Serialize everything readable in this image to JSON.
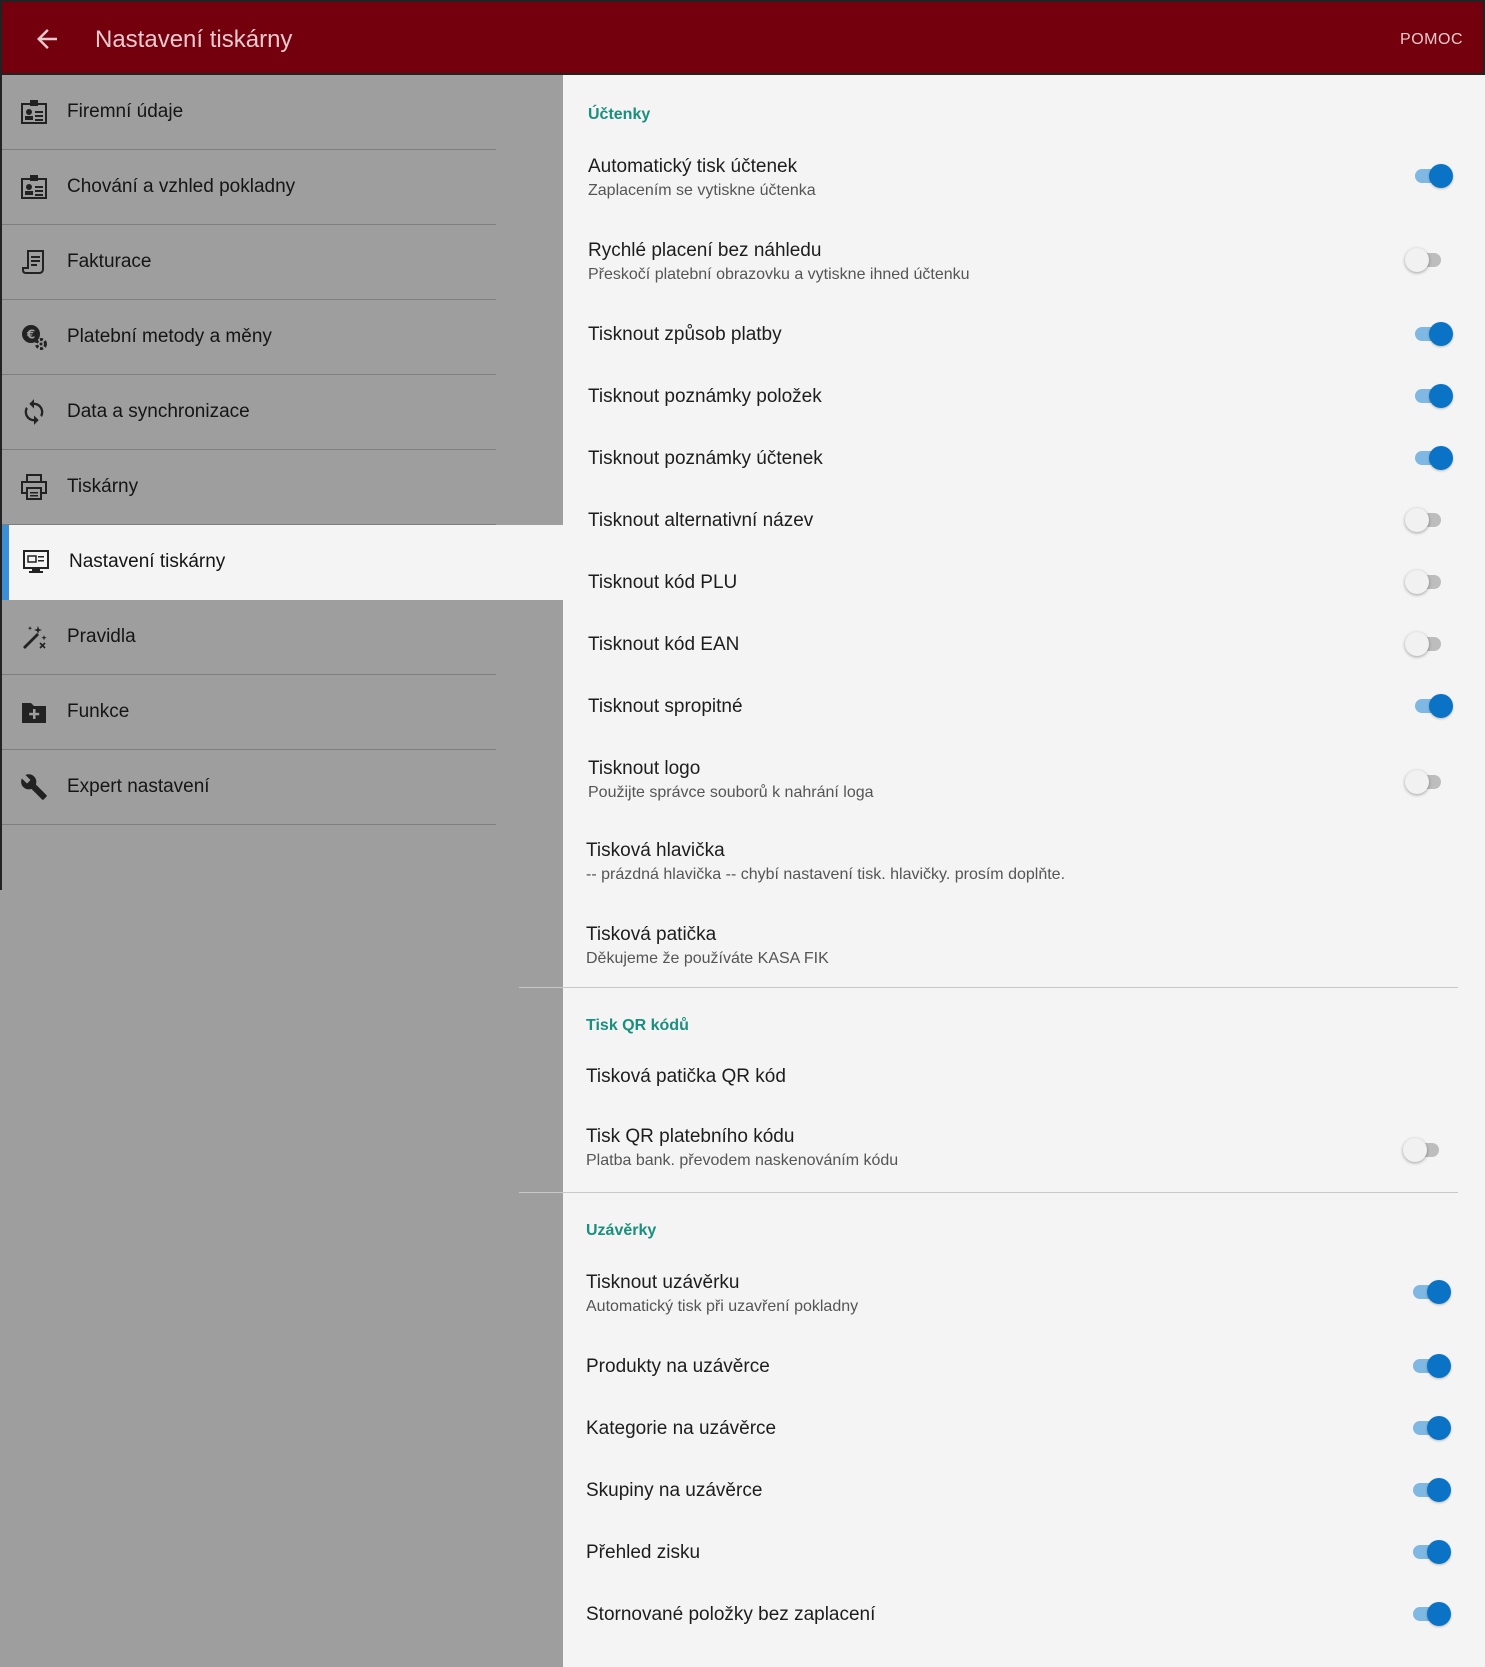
{
  "appbar": {
    "title": "Nastavení tiskárny",
    "help_label": "POMOC",
    "color": "#75000d"
  },
  "sidebar": {
    "items": [
      {
        "label": "Firemní údaje",
        "icon": "company-card-icon",
        "active": false
      },
      {
        "label": "Chování a vzhled pokladny",
        "icon": "company-card-icon",
        "active": false
      },
      {
        "label": "Fakturace",
        "icon": "invoice-icon",
        "active": false
      },
      {
        "label": "Platební metody a měny",
        "icon": "currency-settings-icon",
        "active": false
      },
      {
        "label": "Data a synchronizace",
        "icon": "sync-icon",
        "active": false
      },
      {
        "label": "Tiskárny",
        "icon": "printer-icon",
        "active": false
      },
      {
        "label": "Nastavení tiskárny",
        "icon": "printer-settings-icon",
        "active": true
      },
      {
        "label": "Pravidla",
        "icon": "magic-wand-icon",
        "active": false
      },
      {
        "label": "Funkce",
        "icon": "folder-plus-icon",
        "active": false
      },
      {
        "label": "Expert nastavení",
        "icon": "wrench-icon",
        "active": false
      }
    ]
  },
  "sections": {
    "receipts": "Účtenky",
    "qr": "Tisk QR kódů",
    "closures": "Uzávěrky"
  },
  "settings": [
    {
      "title": "Automatický tisk účtenek",
      "subtitle": "Zaplacením se vytiskne účtenka",
      "toggle": true
    },
    {
      "title": "Rychlé placení bez náhledu",
      "subtitle": "Přeskočí platební obrazovku a vytiskne ihned účtenku",
      "toggle": false
    },
    {
      "title": "Tisknout způsob platby",
      "toggle": true
    },
    {
      "title": "Tisknout poznámky položek",
      "toggle": true
    },
    {
      "title": "Tisknout poznámky účtenek",
      "toggle": true
    },
    {
      "title": "Tisknout alternativní název",
      "toggle": false
    },
    {
      "title": "Tisknout kód PLU",
      "toggle": false
    },
    {
      "title": "Tisknout kód EAN",
      "toggle": false
    },
    {
      "title": "Tisknout spropitné",
      "toggle": true
    },
    {
      "title": "Tisknout logo",
      "subtitle": "Použijte správce souborů k nahrání loga",
      "toggle": false
    },
    {
      "title": "Tisková hlavička",
      "subtitle": "-- prázdná hlavička -- chybí nastavení tisk. hlavičky. prosím doplňte."
    },
    {
      "title": "Tisková patička",
      "subtitle": "Děkujeme že používáte KASA FIK"
    },
    {
      "title": "Tisková patička QR kód"
    },
    {
      "title": "Tisk QR platebního kódu",
      "subtitle": "Platba bank. převodem naskenováním kódu",
      "toggle": false
    },
    {
      "title": "Tisknout uzávěrku",
      "subtitle": "Automatický tisk při uzavření pokladny",
      "toggle": true
    },
    {
      "title": "Produkty na uzávěrce",
      "toggle": true
    },
    {
      "title": "Kategorie na uzávěrce",
      "toggle": true
    },
    {
      "title": "Skupiny na uzávěrce",
      "toggle": true
    },
    {
      "title": "Přehled zisku",
      "toggle": true
    },
    {
      "title": "Stornované položky bez zaplacení",
      "toggle": true
    }
  ],
  "colors": {
    "accent_teal": "#1a8f7e",
    "switch_on": "#0a73c6",
    "active_indicator": "#3a8fd6"
  }
}
